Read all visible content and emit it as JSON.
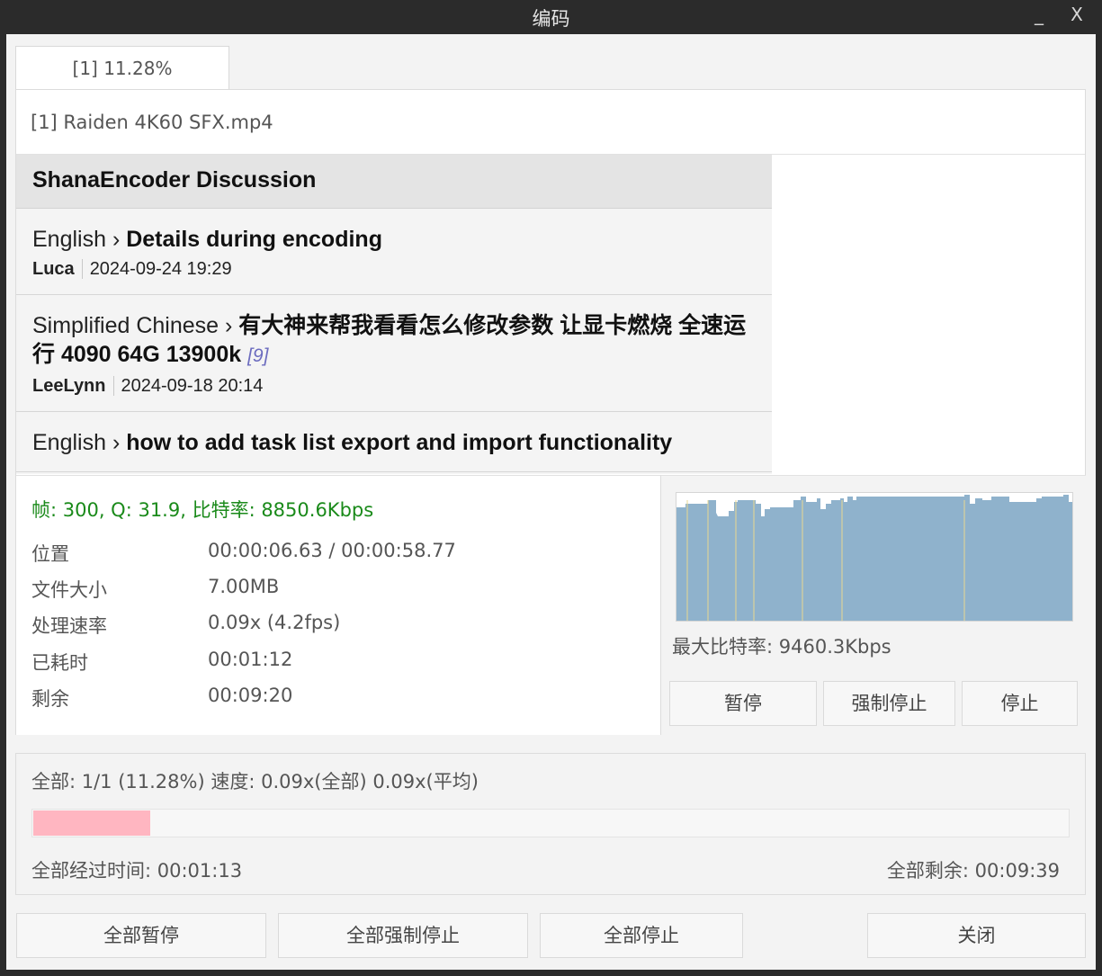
{
  "window": {
    "title": "编码",
    "minimize": "_",
    "close": "X"
  },
  "tab": {
    "label": "[1] 11.28%"
  },
  "file": {
    "name": "[1] Raiden 4K60 SFX.mp4"
  },
  "forum": {
    "header": "ShanaEncoder Discussion",
    "posts": [
      {
        "category": "English",
        "separator": " › ",
        "topic": "Details during encoding",
        "count": "",
        "author": "Luca",
        "date": "2024-09-24 19:29"
      },
      {
        "category": "Simplified Chinese",
        "separator": " › ",
        "topic": "有大神来帮我看看怎么修改参数 让显卡燃烧 全速运行 4090 64G 13900k",
        "count": "[9]",
        "author": "LeeLynn",
        "date": "2024-09-18 20:14"
      },
      {
        "category": "English",
        "separator": " › ",
        "topic": "how to add task list export and import functionality",
        "count": "",
        "author": "",
        "date": ""
      }
    ]
  },
  "stats": {
    "status": "帧: 300, Q: 31.9, 比特率: 8850.6Kbps",
    "position_label": "位置",
    "position_value": "00:00:06.63 / 00:00:58.77",
    "size_label": "文件大小",
    "size_value": "7.00MB",
    "speed_label": "处理速率",
    "speed_value": "0.09x (4.2fps)",
    "elapsed_label": "已耗时",
    "elapsed_value": "00:01:12",
    "remaining_label": "剩余",
    "remaining_value": "00:09:20"
  },
  "bitrate_chart": {
    "max_label": "最大比特率: 9460.3Kbps",
    "fill_color": "#8fb2cc",
    "marker_color": "#e8d890"
  },
  "task_buttons": {
    "pause": "暂停",
    "force_stop": "强制停止",
    "stop": "停止"
  },
  "overall": {
    "summary": "全部: 1/1 (11.28%) 速度: 0.09x(全部) 0.09x(平均)",
    "progress": 0.1128,
    "progress_color": "#ffb6c1",
    "elapsed": "全部经过时间: 00:01:13",
    "remaining": "全部剩余: 00:09:39"
  },
  "bottom_buttons": {
    "pause_all": "全部暂停",
    "force_stop_all": "全部强制停止",
    "stop_all": "全部停止",
    "close": "关闭"
  }
}
